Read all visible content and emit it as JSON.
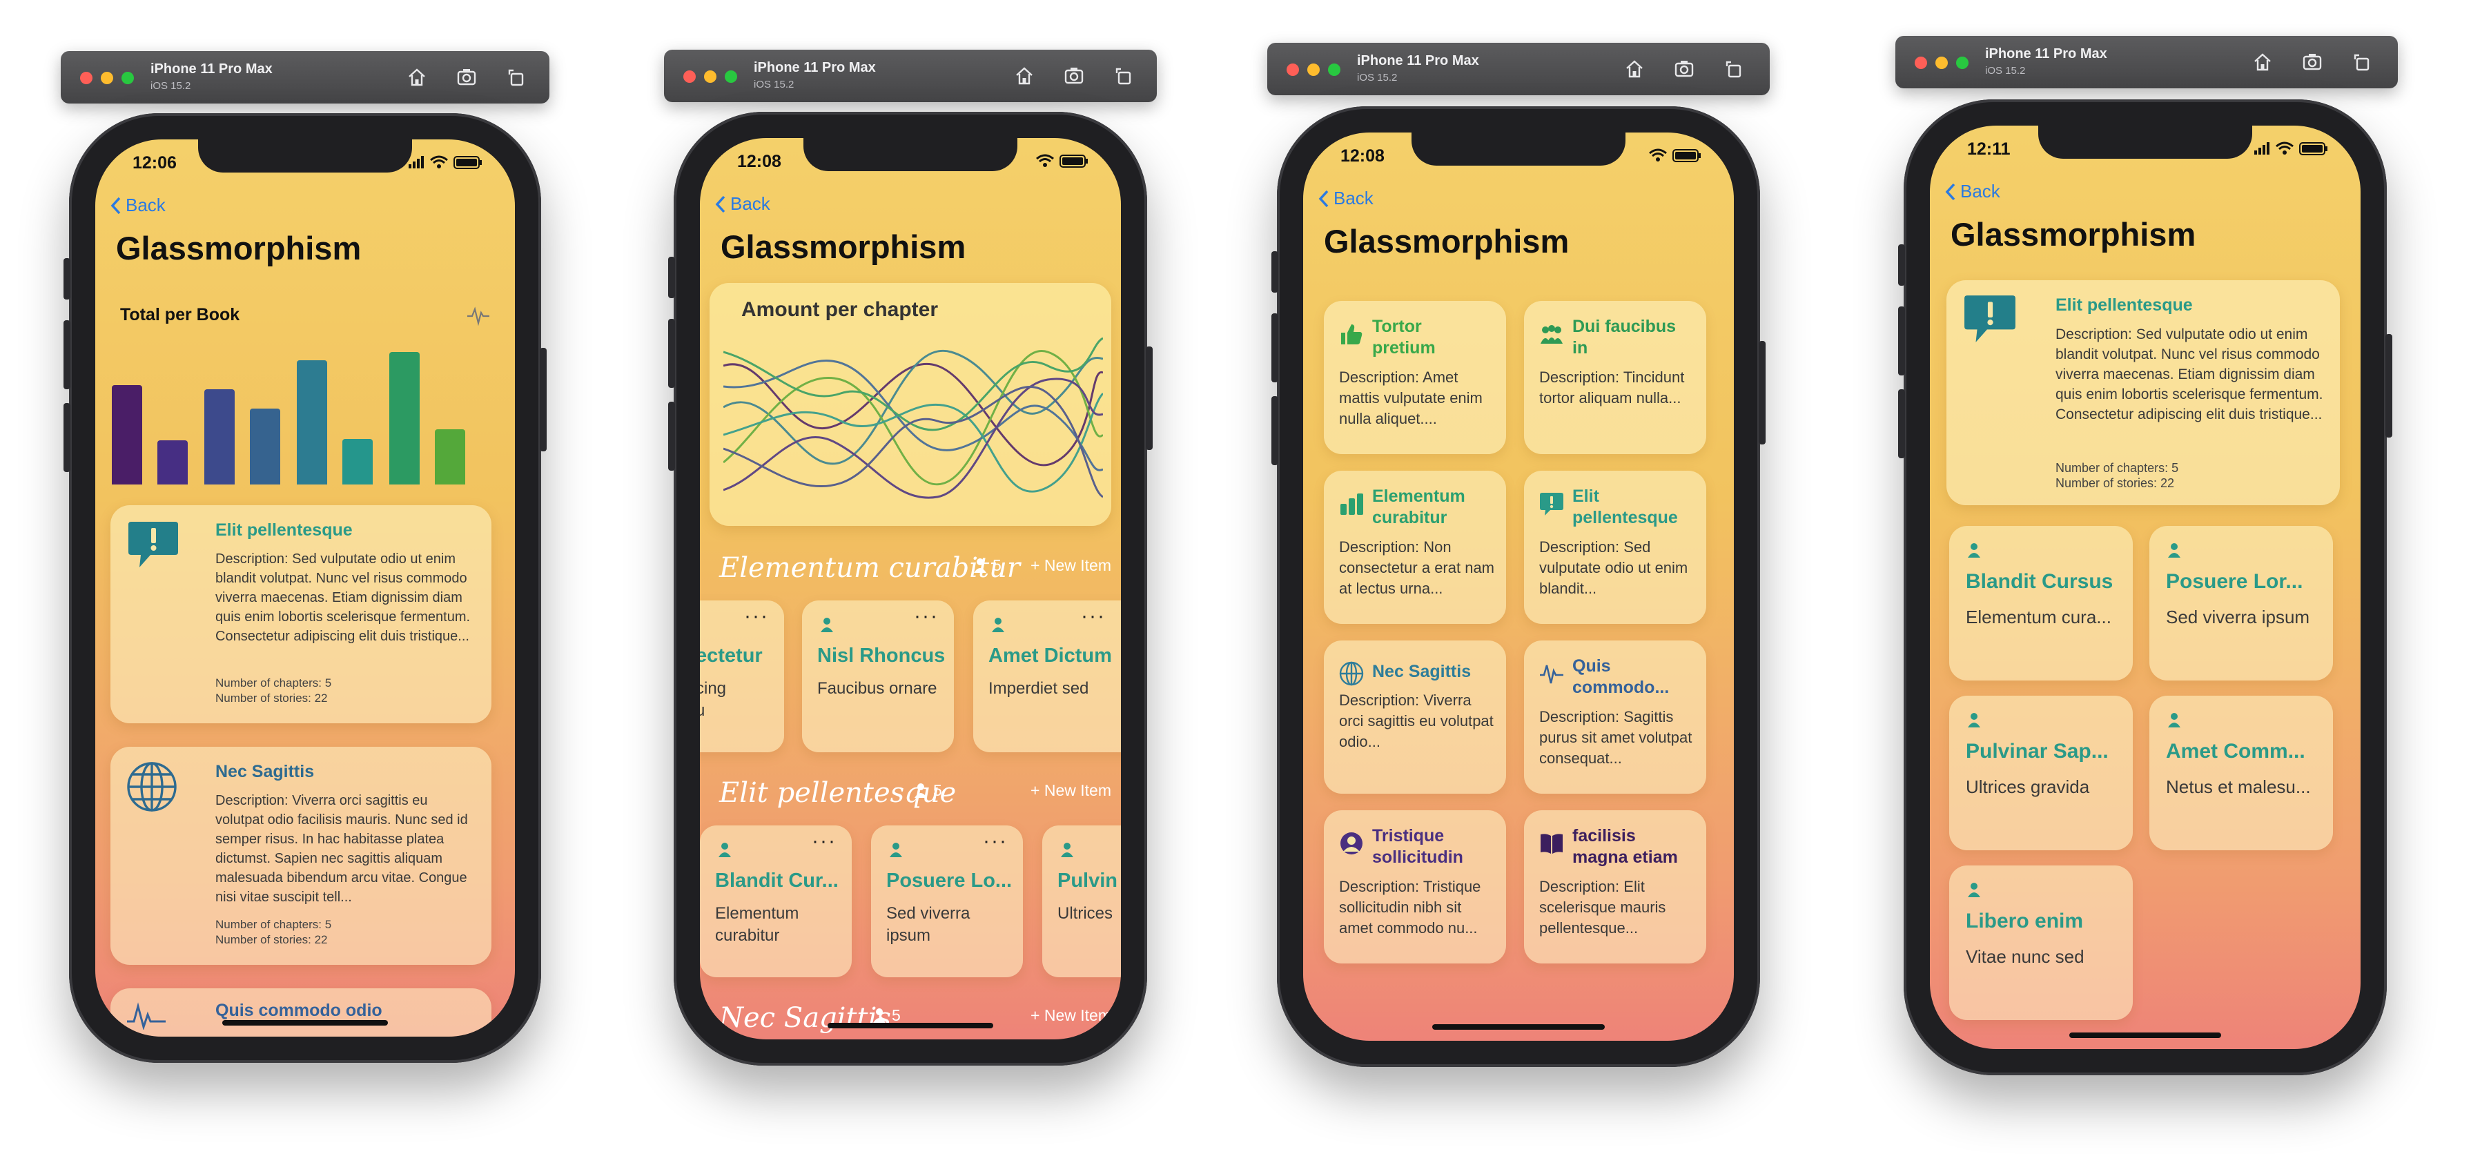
{
  "simulator": {
    "device": "iPhone 11 Pro Max",
    "os": "iOS 15.2"
  },
  "colors": {
    "accent_teal": "#2a9a88",
    "back_blue": "#2a7ae2",
    "bg_top": "#f4d06a",
    "bg_bottom": "#ee8378"
  },
  "common": {
    "back_label": "Back",
    "screen_title": "Glassmorphism"
  },
  "phone1": {
    "time": "12:06",
    "chart": {
      "title": "Total per Book",
      "icon": "waveform-icon"
    },
    "cards": [
      {
        "icon": "exclamation-bubble-icon",
        "title": "Elit pellentesque",
        "desc": "Description: Sed vulputate odio ut enim blandit volutpat. Nunc vel risus commodo viverra maecenas. Etiam dignissim diam quis enim lobortis scelerisque fermentum. Consectetur adipiscing elit duis tristique...",
        "chapters": "Number of chapters: 5",
        "stories": "Number of stories: 22"
      },
      {
        "icon": "globe-icon",
        "title": "Nec Sagittis",
        "desc": "Description: Viverra orci sagittis eu volutpat odio facilisis mauris. Nunc sed id semper risus. In hac habitasse platea dictumst. Sapien nec sagittis aliquam malesuada bibendum arcu vitae. Congue nisi vitae suscipit tell...",
        "chapters": "Number of chapters: 5",
        "stories": "Number of stories: 22"
      },
      {
        "icon": "waveform-icon",
        "title": "Quis commodo odio"
      }
    ]
  },
  "phone2": {
    "time": "12:08",
    "chart_title": "Amount per chapter",
    "sections": [
      {
        "title": "Elementum curabitur",
        "count": "5",
        "new_item": "+ New Item",
        "items": [
          {
            "title": "ectetur",
            "sub": "cing\nu"
          },
          {
            "title": "Nisl Rhoncus",
            "sub": "Faucibus ornare"
          },
          {
            "title": "Amet Dictum",
            "sub": "Imperdiet sed"
          }
        ]
      },
      {
        "title": "Elit pellentesque",
        "count": "5",
        "new_item": "+ New Item",
        "items": [
          {
            "title": "Blandit Cur...",
            "sub": "Elementum\ncurabitur"
          },
          {
            "title": "Posuere Lo...",
            "sub": "Sed viverra\nipsum"
          },
          {
            "title": "Pulvin",
            "sub": "Ultrices"
          }
        ]
      },
      {
        "title": "Nec Sagittis",
        "count": "5",
        "new_item": "+ New Item"
      }
    ]
  },
  "phone3": {
    "time": "12:08",
    "cells": [
      {
        "icon": "thumbs-up-icon",
        "title": "Tortor\npretium",
        "desc": "Description: Amet mattis vulputate enim nulla aliquet....",
        "color": "#38a84a"
      },
      {
        "icon": "people-icon",
        "title": "Dui faucibus\nin",
        "desc": "Description: Tincidunt tortor aliquam nulla...",
        "color": "#2e9a55"
      },
      {
        "icon": "bar-chart-icon",
        "title": "Elementum\ncurabitur",
        "desc": "Description: Non consectetur a erat nam at lectus urna...",
        "color": "#2ba070"
      },
      {
        "icon": "exclamation-bubble-icon",
        "title": "Elit\npellentesque",
        "desc": "Description: Sed vulputate odio ut enim blandit...",
        "color": "#2a9a88"
      },
      {
        "icon": "globe-icon",
        "title": "Nec Sagittis",
        "desc": "Description: Viverra orci sagittis eu volutpat odio...",
        "color": "#2e7d9a"
      },
      {
        "icon": "waveform-icon",
        "title": "Quis\ncommodo...",
        "desc": "Description: Sagittis purus sit amet volutpat consequat...",
        "color": "#35629a"
      },
      {
        "icon": "person-circle-icon",
        "title": "Tristique\nsollicitudin",
        "desc": "Description: Tristique sollicitudin nibh sit amet commodo nu...",
        "color": "#4a2f80"
      },
      {
        "icon": "book-icon",
        "title": "facilisis\nmagna etiam",
        "desc": "Description: Elit scelerisque mauris pellentesque...",
        "color": "#3c1f5e"
      }
    ]
  },
  "phone4": {
    "time": "12:11",
    "top_card": {
      "icon": "exclamation-bubble-icon",
      "title": "Elit pellentesque",
      "desc": "Description: Sed vulputate odio ut enim blandit volutpat. Nunc vel risus commodo viverra maecenas. Etiam dignissim diam quis enim lobortis scelerisque fermentum. Consectetur adipiscing elit duis tristique...",
      "chapters": "Number of chapters: 5",
      "stories": "Number of stories: 22"
    },
    "items": [
      {
        "title": "Blandit Cursus",
        "sub": "Elementum cura..."
      },
      {
        "title": "Posuere Lor...",
        "sub": "Sed viverra ipsum"
      },
      {
        "title": "Pulvinar Sap...",
        "sub": "Ultrices gravida"
      },
      {
        "title": "Amet Comm...",
        "sub": "Netus et malesu..."
      },
      {
        "title": "Libero enim",
        "sub": "Vitae nunc sed"
      }
    ]
  }
}
